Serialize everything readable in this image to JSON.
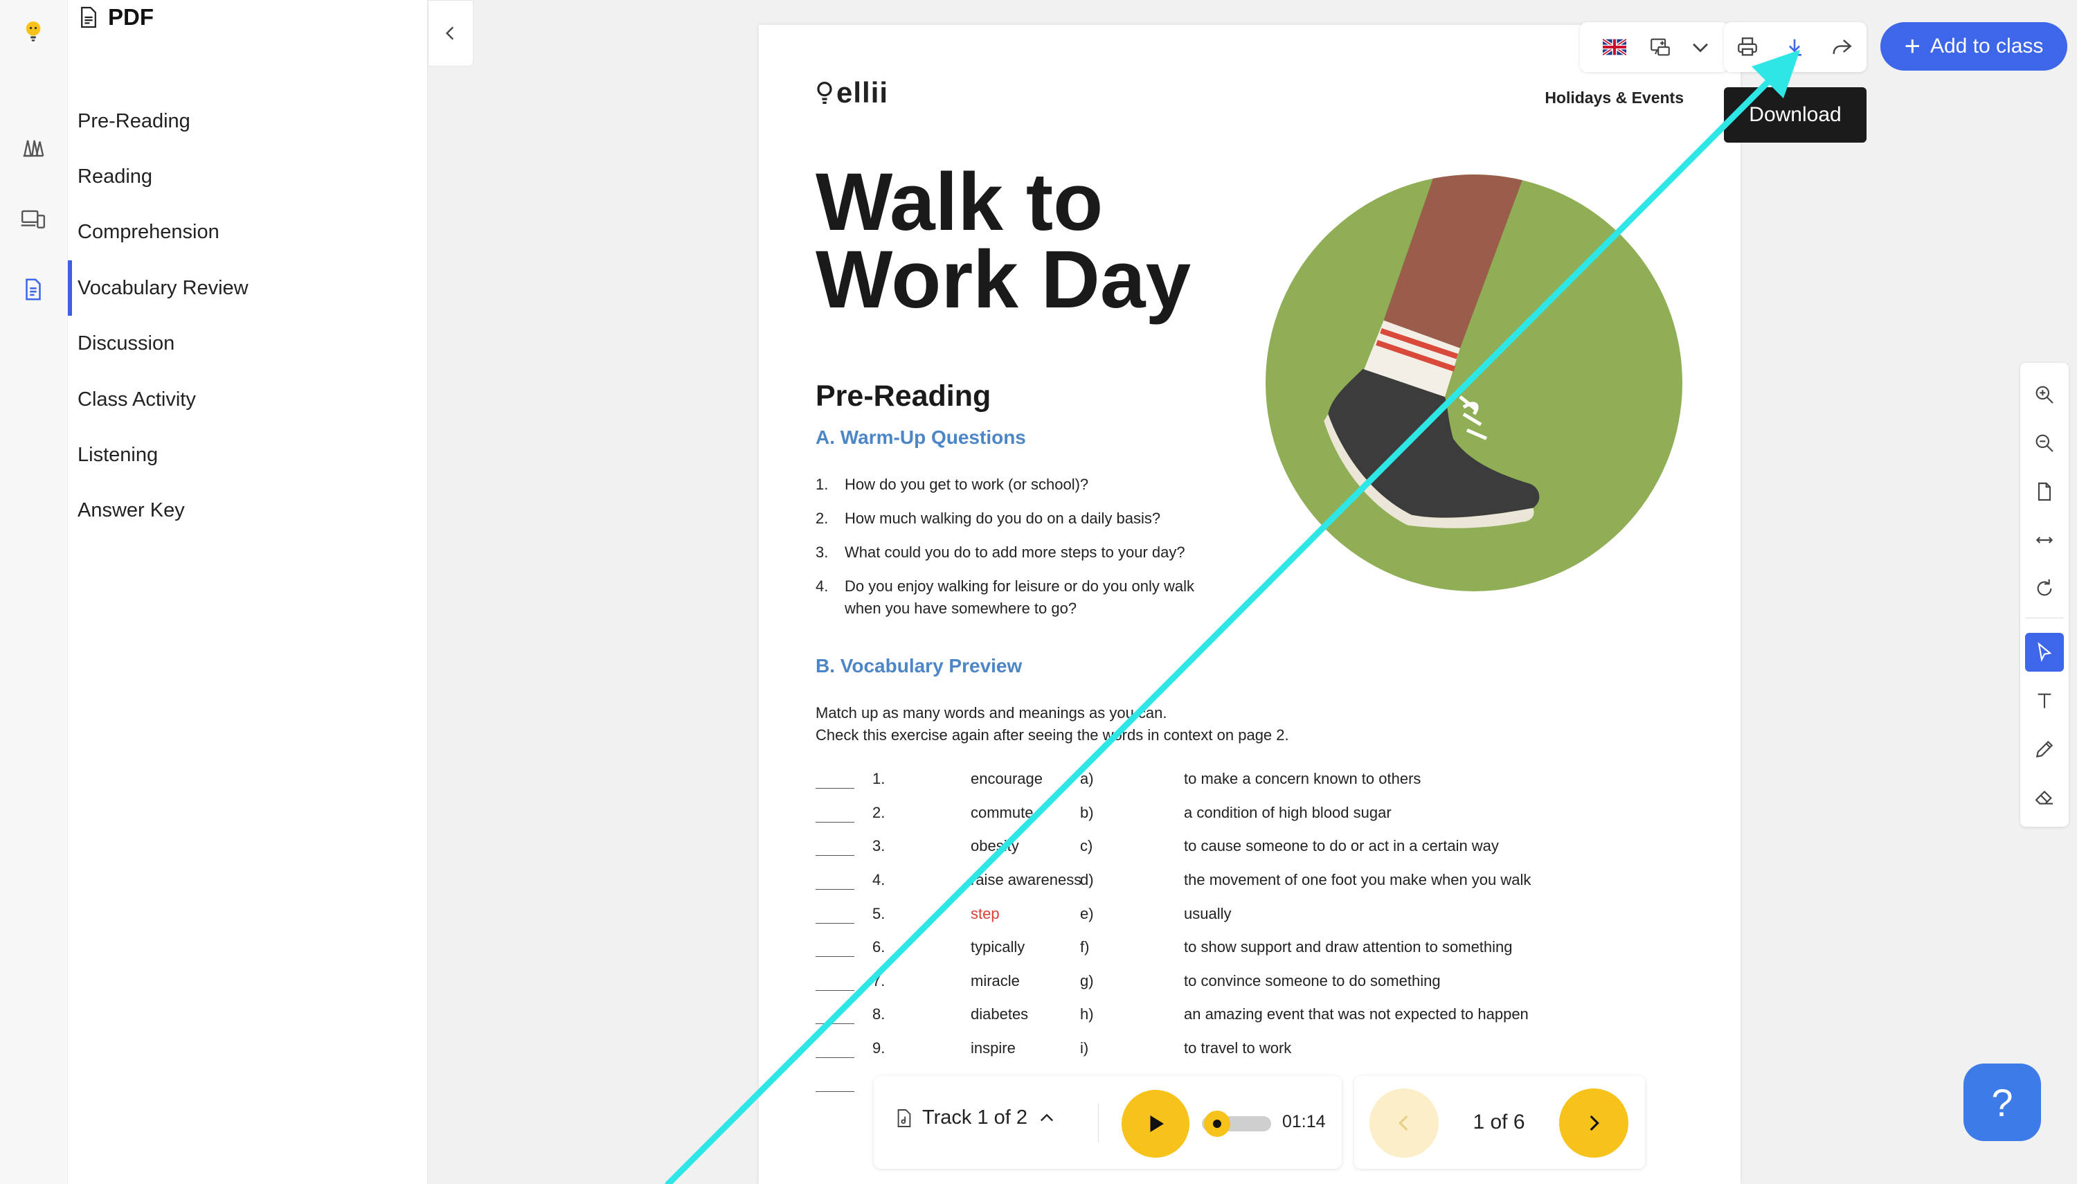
{
  "app": {
    "colors": {
      "accent": "#3d66e8",
      "yellow": "#f7c31a",
      "link_blue": "#4c86c6",
      "annotation_arrow": "#2ee6e6"
    }
  },
  "rail": {
    "icons": [
      "lightbulb-logo-icon",
      "books-icon",
      "devices-icon",
      "document-icon"
    ]
  },
  "sidebar": {
    "title": "PDF",
    "items": [
      {
        "label": "Pre-Reading"
      },
      {
        "label": "Reading"
      },
      {
        "label": "Comprehension"
      },
      {
        "label": "Vocabulary Review",
        "active": true
      },
      {
        "label": "Discussion"
      },
      {
        "label": "Class Activity"
      },
      {
        "label": "Listening"
      },
      {
        "label": "Answer Key"
      }
    ]
  },
  "toolbar": {
    "tooltip": "Download",
    "add_to_class": "Add to class"
  },
  "document": {
    "logo": "ellii",
    "category": "Holidays & Events",
    "title_line1": "Walk to",
    "title_line2": "Work Day",
    "section": "Pre-Reading",
    "warmup_title": "A. Warm-Up Questions",
    "questions": [
      {
        "num": "1.",
        "text": "How do you get to work (or school)?"
      },
      {
        "num": "2.",
        "text": "How much walking do you do on a daily basis?"
      },
      {
        "num": "3.",
        "text": "What could you do to add more steps to your day?"
      },
      {
        "num": "4.",
        "text": "Do you enjoy walking for leisure or do you only walk when you have somewhere to go?"
      }
    ],
    "vocab_title": "B. Vocabulary Preview",
    "instruction_1": "Match up as many words and meanings as you can.",
    "instruction_2": "Check this exercise again after seeing the words in context on page 2.",
    "vocab": [
      {
        "num": "1.",
        "word": "encourage",
        "letter": "a)",
        "meaning": "to make a concern known to others"
      },
      {
        "num": "2.",
        "word": "commute",
        "letter": "b)",
        "meaning": "a condition of high blood sugar"
      },
      {
        "num": "3.",
        "word": "obesity",
        "letter": "c)",
        "meaning": "to cause someone to do or act in a certain way"
      },
      {
        "num": "4.",
        "word": "raise awareness",
        "letter": "d)",
        "meaning": "the movement of one foot you make when you walk"
      },
      {
        "num": "5.",
        "word": "step",
        "letter": "e)",
        "meaning": "usually"
      },
      {
        "num": "6.",
        "word": "typically",
        "letter": "f)",
        "meaning": "to show support and draw attention to something"
      },
      {
        "num": "7.",
        "word": "miracle",
        "letter": "g)",
        "meaning": "to convince someone to do something"
      },
      {
        "num": "8.",
        "word": "diabetes",
        "letter": "h)",
        "meaning": "an amazing event that was not expected to happen"
      },
      {
        "num": "9.",
        "word": "inspire",
        "letter": "i)",
        "meaning": "to travel to work"
      }
    ]
  },
  "audio": {
    "track_label": "Track 1 of 2",
    "time": "01:14",
    "progress": 0.05
  },
  "pager": {
    "text": "1 of 6"
  },
  "help": {
    "label": "?"
  }
}
